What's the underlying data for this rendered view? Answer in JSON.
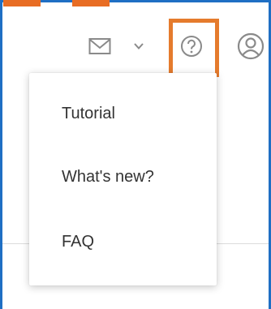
{
  "header": {
    "mail_icon": "envelope-icon",
    "mail_dropdown_icon": "chevron-down-icon",
    "help_icon": "question-circle-icon",
    "profile_icon": "user-circle-icon"
  },
  "help_menu": {
    "items": [
      {
        "label": "Tutorial"
      },
      {
        "label": "What's new?"
      },
      {
        "label": "FAQ"
      }
    ]
  },
  "colors": {
    "frame": "#1f6fc4",
    "highlight": "#e57b2d",
    "tab_accent": "#e86d24",
    "menu_text": "#333333",
    "icon_gray": "#8a8a8a"
  }
}
